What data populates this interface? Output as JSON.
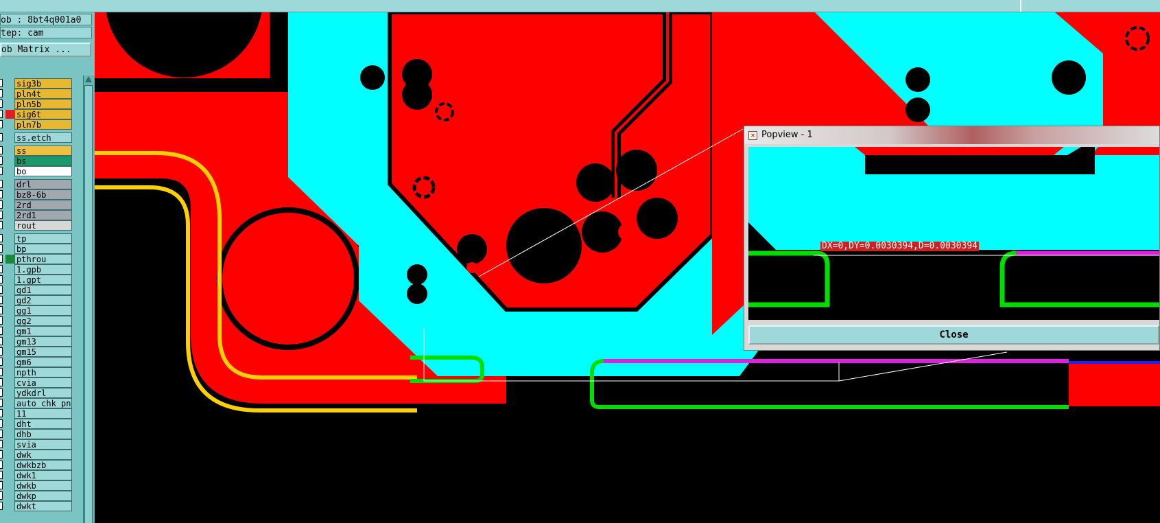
{
  "job_label": "ob : 8bt4q001a0",
  "step_label": "tep: cam",
  "matrix_button": "ob Matrix ...",
  "layers": [
    {
      "name": "sig3b",
      "color": "#e8b830"
    },
    {
      "name": "pln4t",
      "color": "#e8b830"
    },
    {
      "name": "pln5b",
      "color": "#e8b830"
    },
    {
      "name": "sig6t",
      "color": "#e8b830",
      "swatch": "#e02020"
    },
    {
      "name": "pln7b",
      "color": "#e8b830"
    },
    {
      "name": "ss.etch",
      "color": "#9ed8d8"
    },
    {
      "name": "ss",
      "color": "#f0c040"
    },
    {
      "name": "bs",
      "color": "#1a9a6a"
    },
    {
      "name": "bo",
      "color": "#ffffff"
    },
    {
      "name": "drl",
      "color": "#a0a8b0"
    },
    {
      "name": "bz8-6b",
      "color": "#a0a8b0"
    },
    {
      "name": "2rd",
      "color": "#a0a8b0"
    },
    {
      "name": "2rd1",
      "color": "#a0a8b0"
    },
    {
      "name": "rout",
      "color": "#d8d8d8"
    },
    {
      "name": "tp",
      "color": "#9ed8d8"
    },
    {
      "name": "bp",
      "color": "#9ed8d8"
    },
    {
      "name": "pthrou",
      "color": "#9ed8d8",
      "swatch": "#1a8a3a"
    },
    {
      "name": "1.gpb",
      "color": "#9ed8d8"
    },
    {
      "name": "1.gpt",
      "color": "#9ed8d8"
    },
    {
      "name": "gd1",
      "color": "#9ed8d8"
    },
    {
      "name": "gd2",
      "color": "#9ed8d8"
    },
    {
      "name": "gg1",
      "color": "#9ed8d8"
    },
    {
      "name": "gg2",
      "color": "#9ed8d8"
    },
    {
      "name": "gm1",
      "color": "#9ed8d8"
    },
    {
      "name": "gm13",
      "color": "#9ed8d8"
    },
    {
      "name": "gm15",
      "color": "#9ed8d8"
    },
    {
      "name": "gm6",
      "color": "#9ed8d8"
    },
    {
      "name": "npth",
      "color": "#9ed8d8"
    },
    {
      "name": "cvia",
      "color": "#9ed8d8"
    },
    {
      "name": "ydkdrl",
      "color": "#9ed8d8"
    },
    {
      "name": "auto_chk_pn",
      "color": "#9ed8d8"
    },
    {
      "name": "11",
      "color": "#9ed8d8"
    },
    {
      "name": "dht",
      "color": "#9ed8d8"
    },
    {
      "name": "dhb",
      "color": "#9ed8d8"
    },
    {
      "name": "svia",
      "color": "#9ed8d8"
    },
    {
      "name": "dwk",
      "color": "#9ed8d8"
    },
    {
      "name": "dwkbzb",
      "color": "#9ed8d8"
    },
    {
      "name": "dwk1",
      "color": "#9ed8d8"
    },
    {
      "name": "dwkb",
      "color": "#9ed8d8"
    },
    {
      "name": "dwkp",
      "color": "#9ed8d8"
    },
    {
      "name": "dwkt",
      "color": "#9ed8d8"
    }
  ],
  "popview": {
    "title": "Popview - 1",
    "measurement": "DX=0,DY=0.0030394,D=0.0030394",
    "close_label": "Close"
  },
  "colors": {
    "copper": "#ff0000",
    "mask": "#00ffff",
    "highlight": "#00dd00",
    "magenta": "#e020e0",
    "trace_yellow": "#ffd000"
  }
}
